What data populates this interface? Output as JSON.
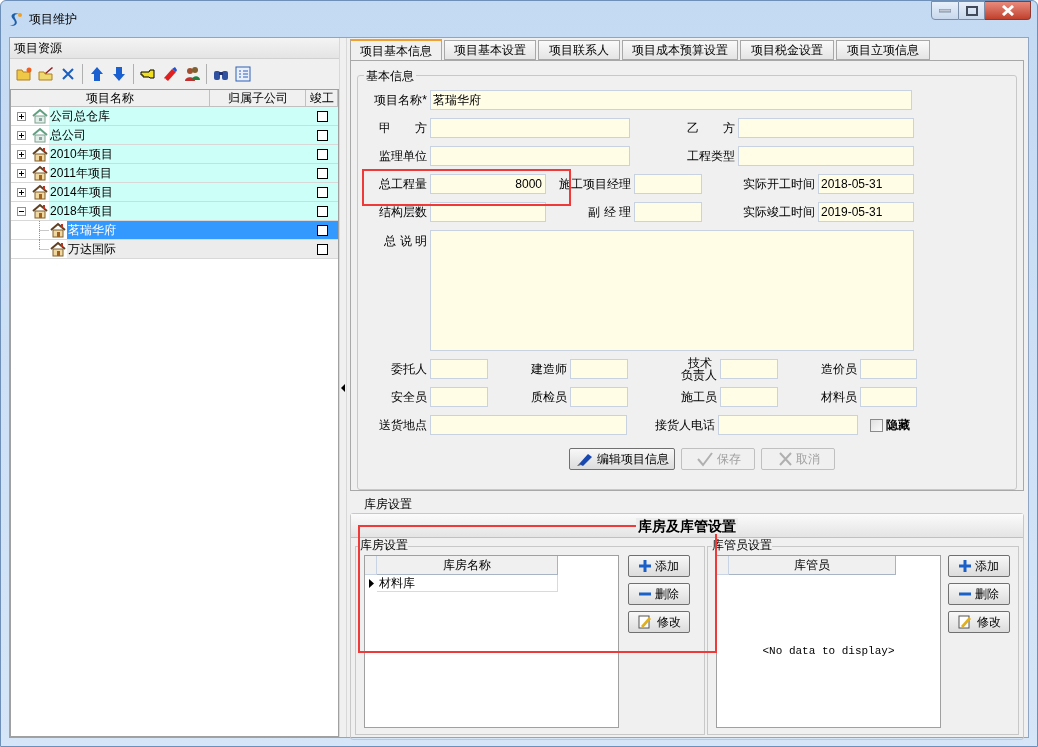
{
  "window": {
    "title": "项目维护"
  },
  "left_panel": {
    "title": "项目资源",
    "columns": [
      "项目名称",
      "归属子公司",
      "竣工"
    ],
    "items": [
      {
        "name": "公司总仓库",
        "kind": "company",
        "expanded": false,
        "checked": false,
        "selected": false
      },
      {
        "name": "总公司",
        "kind": "company",
        "expanded": false,
        "checked": false,
        "selected": false
      },
      {
        "name": "2010年项目",
        "kind": "project",
        "expanded": false,
        "checked": false,
        "selected": false
      },
      {
        "name": "2011年项目",
        "kind": "project",
        "expanded": false,
        "checked": false,
        "selected": false
      },
      {
        "name": "2014年项目",
        "kind": "project",
        "expanded": false,
        "checked": false,
        "selected": false
      },
      {
        "name": "2018年项目",
        "kind": "project",
        "expanded": true,
        "checked": false,
        "selected": false,
        "children": [
          {
            "name": "茗瑞华府",
            "kind": "project",
            "checked": false,
            "selected": true
          },
          {
            "name": "万达国际",
            "kind": "project",
            "checked": false,
            "selected": false
          }
        ]
      }
    ]
  },
  "tabs": [
    {
      "label": "项目基本信息",
      "selected": true
    },
    {
      "label": "项目基本设置",
      "selected": false
    },
    {
      "label": "项目联系人",
      "selected": false
    },
    {
      "label": "项目成本预算设置",
      "selected": false
    },
    {
      "label": "项目税金设置",
      "selected": false
    },
    {
      "label": "项目立项信息",
      "selected": false
    }
  ],
  "basic_info": {
    "title": "基本信息",
    "rows": [
      [
        {
          "label": "项目名称*",
          "value": "茗瑞华府"
        }
      ],
      [
        {
          "label": "甲　　方"
        },
        {
          "label": "乙　　方"
        }
      ],
      [
        {
          "label": "监理单位"
        },
        {
          "label": "工程类型"
        }
      ],
      [
        {
          "label": "总工程量",
          "value": "8000",
          "kind": "number"
        },
        {
          "label": "施工项目经理"
        },
        {
          "label": "实际开工时间",
          "value": "2018-05-31"
        }
      ],
      [
        {
          "label": "结构层数"
        },
        {
          "label": "副 经 理"
        },
        {
          "label": "实际竣工时间",
          "value": "2019-05-31"
        }
      ],
      [
        {
          "label": "总 说 明",
          "kind": "memo"
        }
      ],
      [
        {
          "label": "委托人"
        },
        {
          "label": "建造师"
        },
        {
          "label_lines": [
            "技术",
            "负责人"
          ]
        },
        {
          "label": "造价员"
        }
      ],
      [
        {
          "label": "安全员"
        },
        {
          "label": "质检员"
        },
        {
          "label": "施工员"
        },
        {
          "label": "材料员"
        }
      ],
      [
        {
          "label": "送货地点"
        },
        {
          "label": "接货人电话"
        }
      ]
    ],
    "hidden_checkbox": {
      "label": "隐藏",
      "checked": false
    },
    "buttons": [
      {
        "label": "编辑项目信息",
        "kind": "edit",
        "disabled": false
      },
      {
        "label": "保存",
        "kind": "save",
        "disabled": true
      },
      {
        "label": "取消",
        "kind": "cancel",
        "disabled": true
      }
    ]
  },
  "warehouse": {
    "title": "库房设置",
    "banner": "库房及库管设置",
    "storerooms": {
      "title": "库房设置",
      "column": "库房名称",
      "rows": [
        {
          "name": "材料库",
          "current": true
        }
      ],
      "buttons": [
        {
          "label": "添加",
          "kind": "add"
        },
        {
          "label": "删除",
          "kind": "delete"
        },
        {
          "label": "修改",
          "kind": "modify"
        }
      ]
    },
    "keepers": {
      "title": "库管员设置",
      "column": "库管员",
      "empty_text": "<No data to display>",
      "buttons": [
        {
          "label": "添加",
          "kind": "add"
        },
        {
          "label": "删除",
          "kind": "delete"
        },
        {
          "label": "修改",
          "kind": "modify"
        }
      ]
    }
  }
}
